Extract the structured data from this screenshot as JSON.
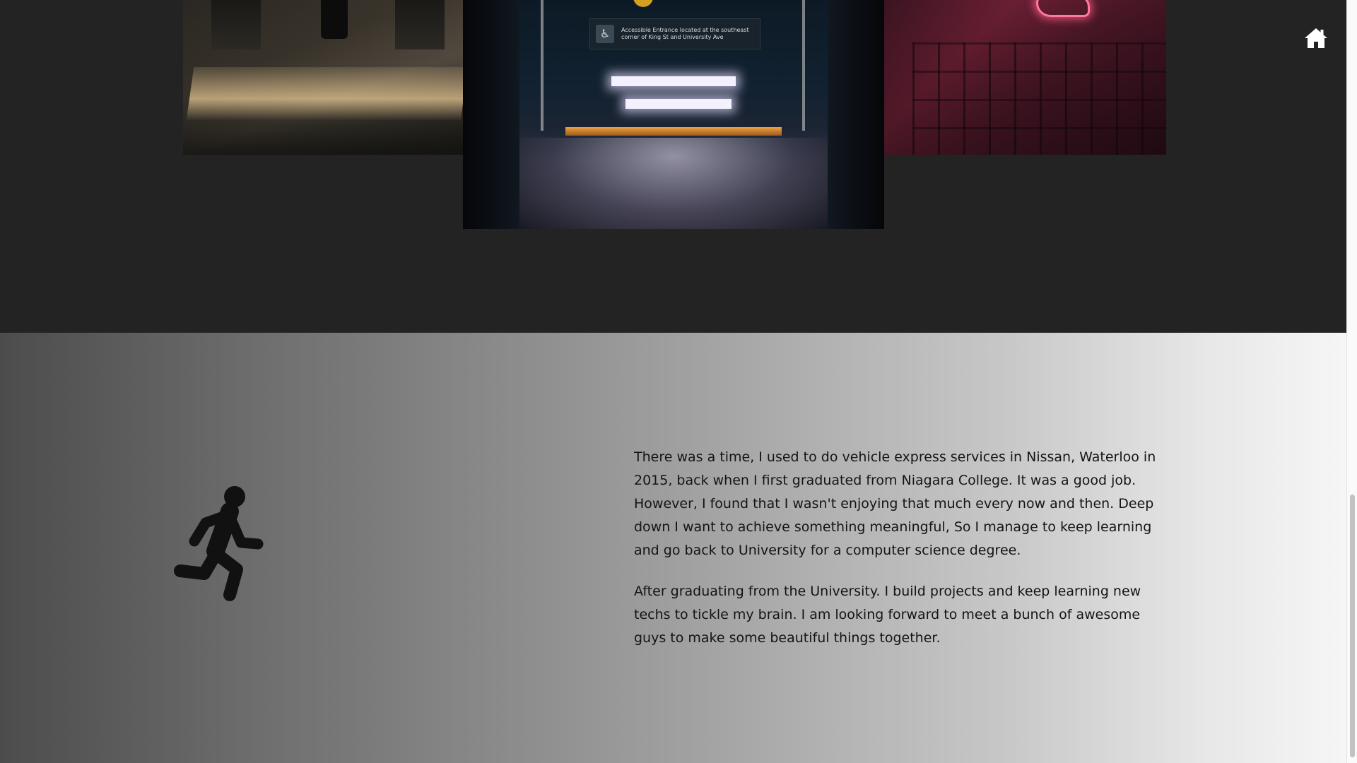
{
  "gallery": {
    "photos": [
      {
        "name": "hotel-lobby-photo"
      },
      {
        "name": "subway-entrance-photo",
        "sign_text": "Accessible Entrance located at the southeast corner of King St and University Ave"
      },
      {
        "name": "neon-building-photo"
      }
    ]
  },
  "nav": {
    "home_icon": "home-icon"
  },
  "about": {
    "icon": "running-person-icon",
    "paragraphs": [
      "There was a time, I used to do vehicle express services in Nissan, Waterloo in 2015, back when I first graduated from Niagara College. It was a good job. However, I found that I wasn't enjoying that much every now and then. Deep down I want to achieve something meaningful, So I manage to keep learning and go back to University for a computer science degree.",
      "After graduating from the University. I build projects and keep learning new techs to tickle my brain. I am looking forward to meet a bunch of awesome guys to make some beautiful things together."
    ]
  },
  "colors": {
    "gallery_bg": "#232323",
    "text": "#141414",
    "icon": "#111111"
  }
}
